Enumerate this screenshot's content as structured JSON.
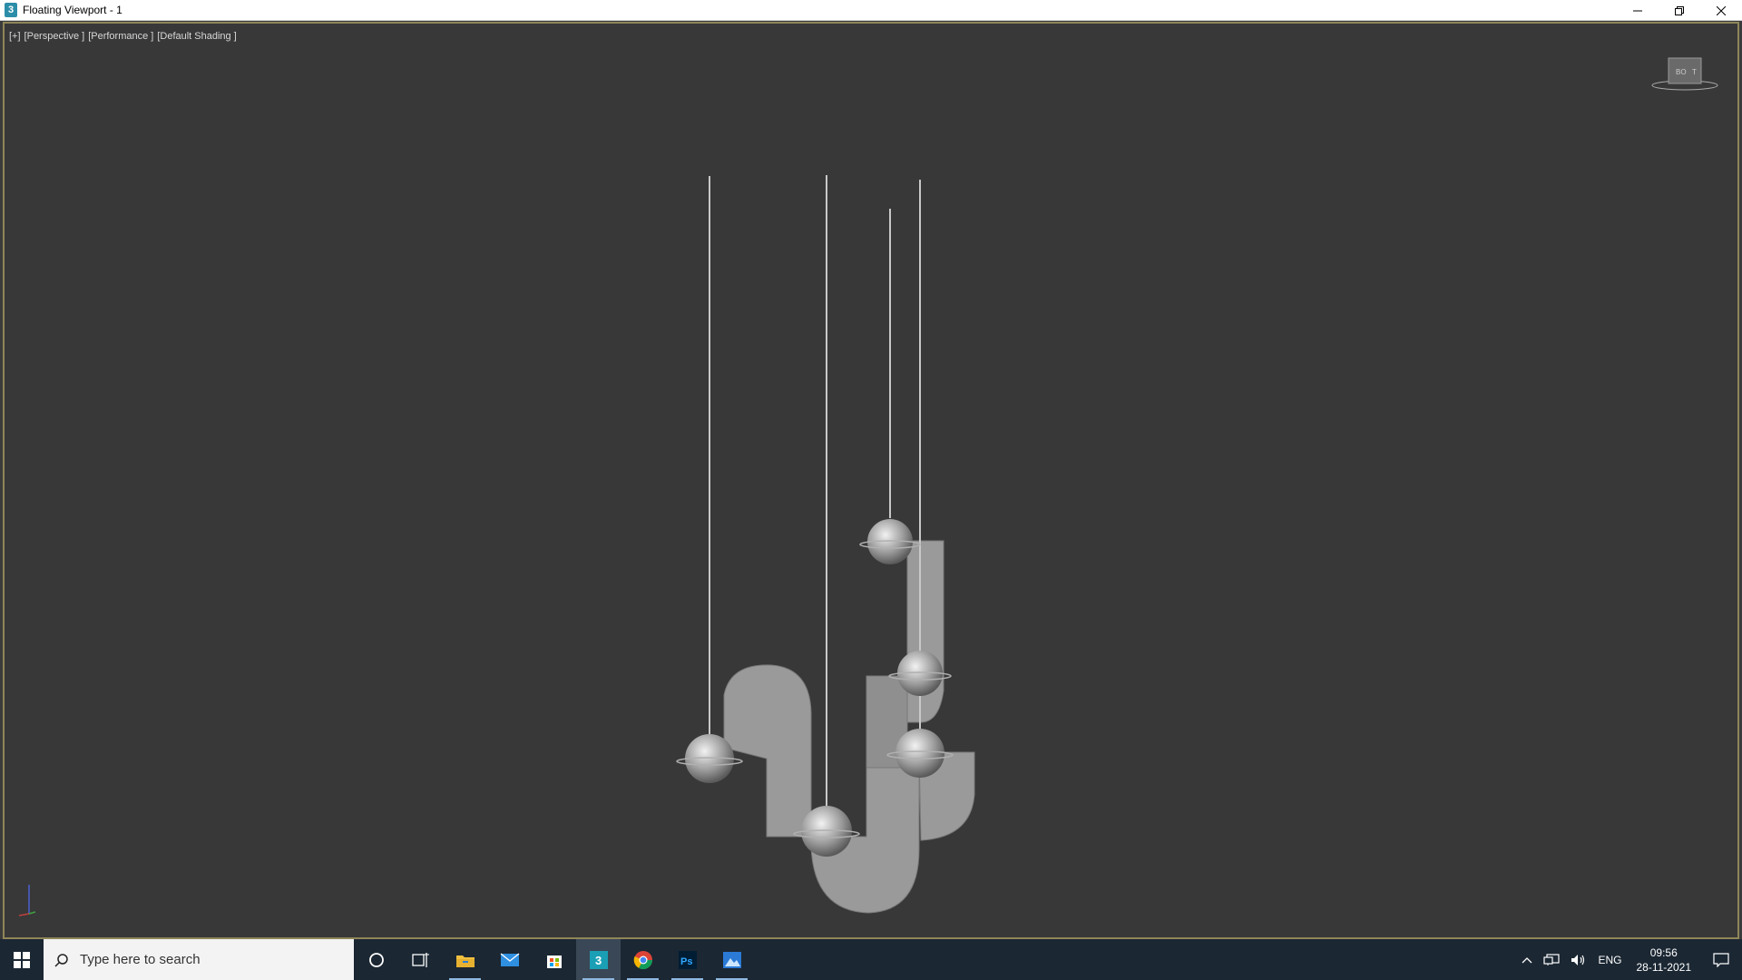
{
  "window": {
    "title": "Floating Viewport - 1",
    "app_icon_label": "3",
    "minimize_icon": "minimize-icon",
    "restore_icon": "restore-icon",
    "close_icon": "close-icon"
  },
  "viewport": {
    "labels": [
      "[+]",
      "[Perspective ]",
      "[Performance ]",
      "[Default Shading ]"
    ],
    "viewcube_labels": [
      "BO",
      "T"
    ],
    "colors": {
      "background": "#383838",
      "border": "#8f8658",
      "object": "#9a9a9a"
    }
  },
  "taskbar": {
    "search_placeholder": "Type here to search",
    "apps": [
      {
        "name": "cortana",
        "icon": "circle-icon"
      },
      {
        "name": "task-view",
        "icon": "task-view-icon"
      },
      {
        "name": "file-explorer",
        "icon": "folder-icon"
      },
      {
        "name": "mail",
        "icon": "mail-icon"
      },
      {
        "name": "store",
        "icon": "store-icon"
      },
      {
        "name": "3ds-max",
        "icon": "3dsmax-icon",
        "label": "3"
      },
      {
        "name": "chrome",
        "icon": "chrome-icon"
      },
      {
        "name": "photoshop",
        "icon": "photoshop-icon",
        "label": "Ps"
      },
      {
        "name": "photos",
        "icon": "photos-icon"
      }
    ],
    "tray": {
      "language": "ENG",
      "time": "09:56",
      "date": "28-11-2021"
    }
  }
}
